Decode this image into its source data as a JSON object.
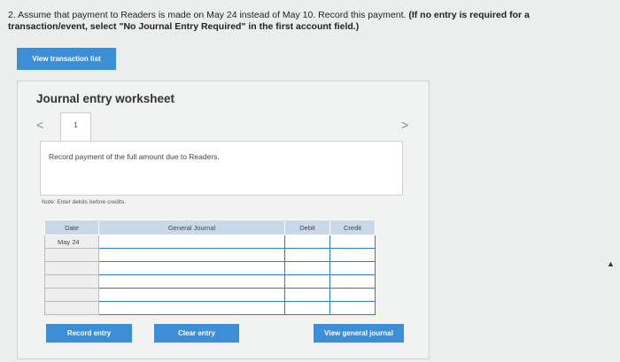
{
  "question": {
    "text": "2. Assume that payment to Readers is made on May 24 instead of May 10. Record this payment.",
    "instruction": "(If no entry is required for a transaction/event, select \"No Journal Entry Required\" in the first account field.)"
  },
  "buttons": {
    "view_transaction_list": "View transaction list",
    "record_entry": "Record entry",
    "clear_entry": "Clear entry",
    "view_general_journal": "View general journal"
  },
  "worksheet": {
    "title": "Journal entry worksheet",
    "nav_prev": "<",
    "nav_next": ">",
    "current_page": "1",
    "description": "Record payment of the full amount due to Readers.",
    "note": "Note: Enter debits before credits."
  },
  "table": {
    "headers": {
      "date": "Date",
      "account": "General Journal",
      "debit": "Debit",
      "credit": "Credit"
    },
    "rows": [
      {
        "date": "May 24"
      },
      {
        "date": ""
      },
      {
        "date": ""
      },
      {
        "date": ""
      },
      {
        "date": ""
      },
      {
        "date": ""
      }
    ]
  },
  "colors": {
    "primary_button": "#3c8fd6",
    "table_header": "#c9d9ea",
    "field_border": "#2f7cc4"
  },
  "icons": [
    "chevron-left-icon",
    "chevron-right-icon",
    "mouse-cursor-icon"
  ]
}
